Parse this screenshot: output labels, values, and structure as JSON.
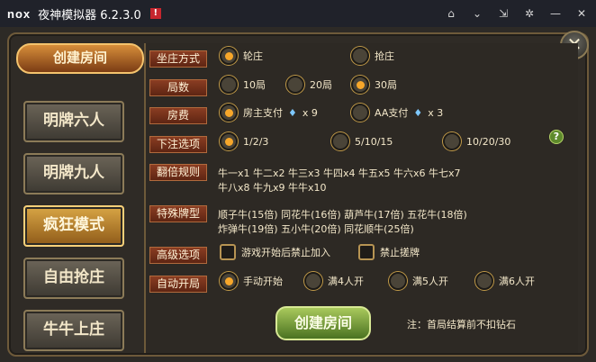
{
  "titlebar": {
    "logo": "nox",
    "title": "夜神模拟器 6.2.3.0",
    "flag": "!",
    "controls": [
      "home-icon",
      "dropdown-icon",
      "pin-icon",
      "settings-icon",
      "minimize-icon",
      "close-icon"
    ]
  },
  "sidebar": {
    "header": "创建房间",
    "items": [
      {
        "label": "明牌六人"
      },
      {
        "label": "明牌九人"
      },
      {
        "label": "疯狂模式"
      },
      {
        "label": "自由抢庄"
      },
      {
        "label": "牛牛上庄"
      }
    ],
    "active_index": 2
  },
  "form": {
    "seat_mode": {
      "label": "坐庄方式",
      "options": [
        "轮庄",
        "抢庄"
      ],
      "selected": 0
    },
    "rounds": {
      "label": "局数",
      "options": [
        "10局",
        "20局",
        "30局"
      ],
      "selected": 2
    },
    "fee": {
      "label": "房费",
      "options": [
        {
          "text": "房主支付",
          "gem": "x 9"
        },
        {
          "text": "AA支付",
          "gem": "x 3"
        }
      ],
      "selected": 0
    },
    "bet": {
      "label": "下注选项",
      "options": [
        "1/2/3",
        "5/10/15",
        "10/20/30"
      ],
      "selected": 0
    },
    "multiplier": {
      "label": "翻倍规则",
      "lines": [
        "牛一x1 牛二x2 牛三x3 牛四x4 牛五x5 牛六x6 牛七x7",
        "牛八x8 牛九x9 牛牛x10"
      ]
    },
    "special": {
      "label": "特殊牌型",
      "lines": [
        "顺子牛(15倍) 同花牛(16倍) 葫芦牛(17倍) 五花牛(18倍)",
        "炸弹牛(19倍) 五小牛(20倍) 同花顺牛(25倍)"
      ]
    },
    "advanced": {
      "label": "高级选项",
      "options": [
        "游戏开始后禁止加入",
        "禁止搓牌"
      ]
    },
    "autostart": {
      "label": "自动开局",
      "options": [
        "手动开始",
        "满4人开",
        "满5人开",
        "满6人开"
      ],
      "selected": 0
    }
  },
  "buttons": {
    "create": "创建房间",
    "close": "✕"
  },
  "note": "注：首局结算前不扣钻石"
}
